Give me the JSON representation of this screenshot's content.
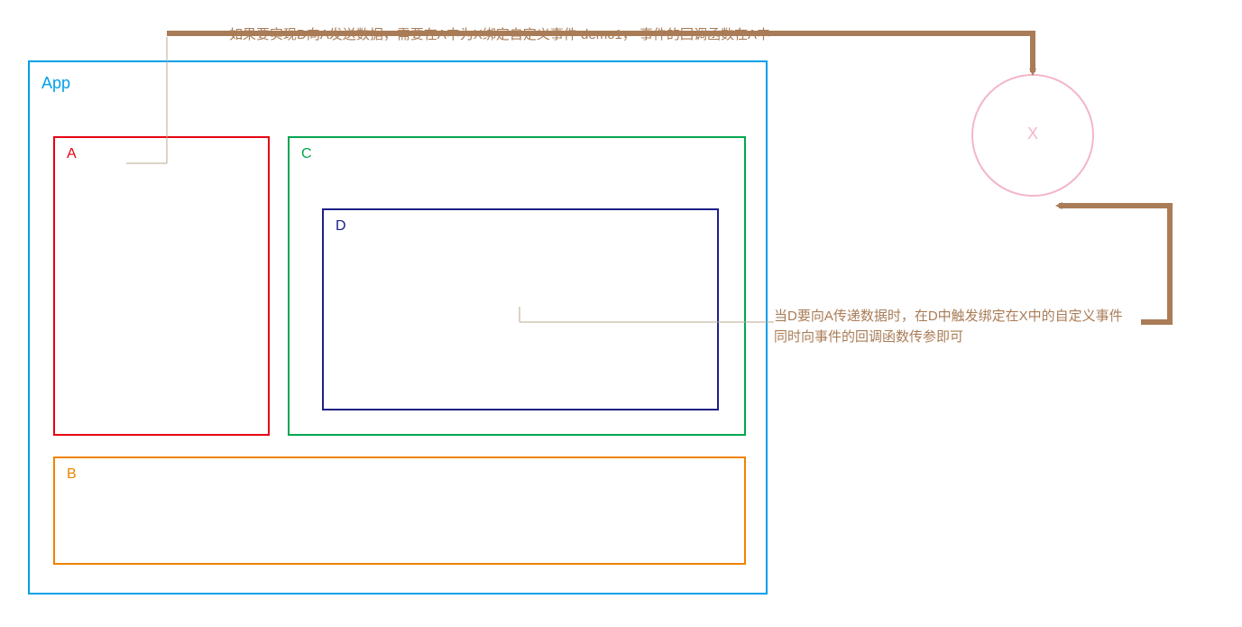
{
  "labels": {
    "app": "App",
    "a": "A",
    "b": "B",
    "c": "C",
    "d": "D",
    "x": "X"
  },
  "annotations": {
    "top": "如果要实现D向A发送数据，需要在A中为X绑定自定义事件 demo1，  事件的回调函数在A中",
    "right_line1": "当D要向A传递数据时，在D中触发绑定在X中的自定义事件",
    "right_line2": "同时向事件的回调函数传参即可"
  },
  "colors": {
    "app_border": "#00a0e9",
    "a_border": "#e60012",
    "b_border": "#f08300",
    "c_border": "#00a650",
    "d_border": "#1d2088",
    "x_stroke": "#f3b6c7",
    "x_text": "#f3b6c7",
    "arrow": "#a97c57",
    "annot_text": "#a97c57",
    "thin_line": "#b8a98f"
  },
  "chart_data": {
    "type": "diagram",
    "title": "",
    "components": [
      {
        "id": "App",
        "contains": [
          "A",
          "B",
          "C"
        ]
      },
      {
        "id": "A"
      },
      {
        "id": "B"
      },
      {
        "id": "C",
        "contains": [
          "D"
        ]
      },
      {
        "id": "D"
      },
      {
        "id": "X",
        "shape": "circle"
      }
    ],
    "relations": [
      {
        "from": "annotation_top",
        "to": "A",
        "style": "thin-pointer"
      },
      {
        "from": "annotation_top",
        "to": "X",
        "style": "thick-arrow"
      },
      {
        "from": "D",
        "to": "annotation_right",
        "style": "thin-pointer"
      },
      {
        "from": "annotation_right",
        "to": "X",
        "style": "thick-arrow"
      }
    ],
    "notes": [
      "如果要实现D向A发送数据，需要在A中为X绑定自定义事件 demo1，事件的回调函数在A中",
      "当D要向A传递数据时，在D中触发绑定在X中的自定义事件，同时向事件的回调函数传参即可"
    ]
  }
}
